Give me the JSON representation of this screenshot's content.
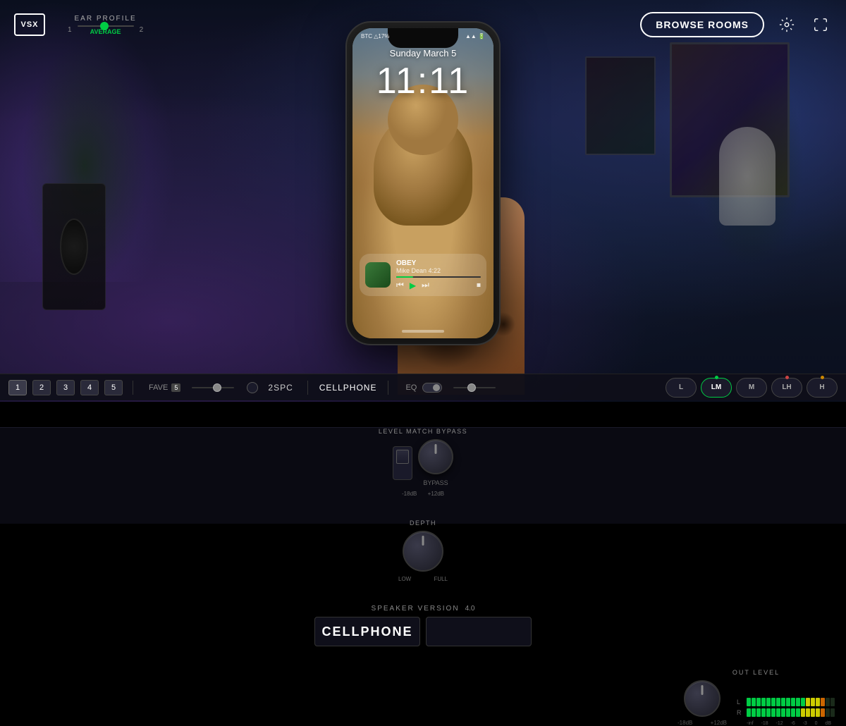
{
  "header": {
    "logo": "VSX",
    "ear_profile": {
      "label": "EAR PROFILE",
      "slider_value": "AVERAGE",
      "min": "1",
      "max": "2"
    },
    "browse_rooms": "BROWSE ROOMS"
  },
  "transport": {
    "presets": [
      "1",
      "2",
      "3",
      "4",
      "5"
    ],
    "active_preset": "1",
    "fave_label": "FAVE",
    "fave_num": "5",
    "mode_2spc": "2SPC",
    "mode_cellphone": "CELLPHONE",
    "eq_label": "EQ",
    "speaker_modes": [
      {
        "label": "L",
        "active": false,
        "dot": false
      },
      {
        "label": "LM",
        "active": true,
        "dot": true
      },
      {
        "label": "M",
        "active": false,
        "dot": false
      },
      {
        "label": "LH",
        "active": false,
        "dot": true
      },
      {
        "label": "H",
        "active": false,
        "dot": true
      }
    ]
  },
  "controls": {
    "level_match_bypass": {
      "label": "LEVEL MATCH BYPASS",
      "switch_label": "BYPASS",
      "min": "-18dB",
      "max": "+12dB"
    },
    "depth": {
      "label": "DEPTH",
      "min": "LOW",
      "max": "FULL"
    },
    "speaker_version": {
      "label": "SPEAKER VERSION",
      "version": "4.0",
      "display": "CELLPHONE"
    },
    "out_level": {
      "label": "OUT LEVEL",
      "min": "-18dB",
      "max": "+12dB",
      "left_label": "L",
      "right_label": "R",
      "meter_labels": [
        "-inf",
        "-18",
        "-12",
        "-6",
        "-3",
        "0",
        "dB"
      ]
    }
  },
  "phone": {
    "date": "Sunday March 5",
    "time": "11:11",
    "music_title": "OBEY",
    "music_artist": "Mike Dean 4:22"
  }
}
